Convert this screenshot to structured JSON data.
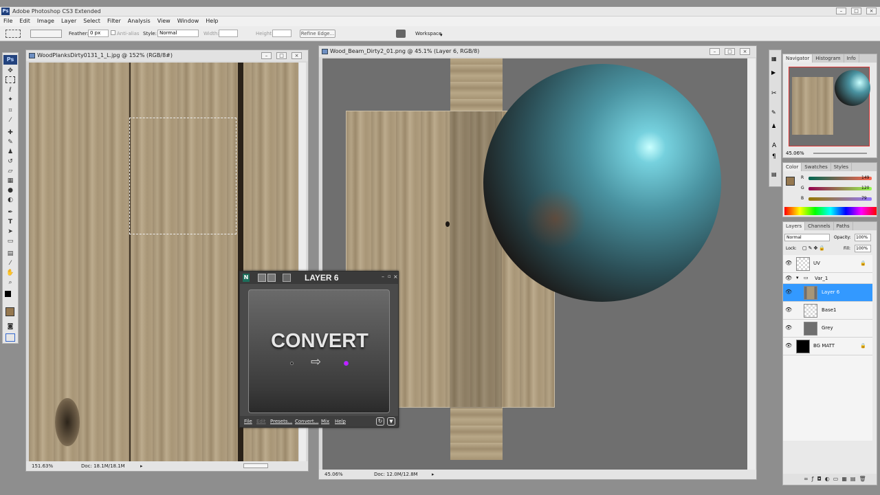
{
  "app": {
    "title": "Adobe Photoshop CS3 Extended",
    "icon_text": "Ps"
  },
  "menu": [
    "File",
    "Edit",
    "Image",
    "Layer",
    "Select",
    "Filter",
    "Analysis",
    "View",
    "Window",
    "Help"
  ],
  "options": {
    "feather_label": "Feather:",
    "feather_value": "0 px",
    "antialias_label": "Anti-alias",
    "style_label": "Style:",
    "style_value": "Normal",
    "width_label": "Width:",
    "height_label": "Height:",
    "refine_edge": "Refine Edge...",
    "workspace": "Workspace"
  },
  "doc1": {
    "title": "WoodPlanksDirty0131_1_L.jpg @ 152% (RGB/8#)",
    "zoom": "151.63%",
    "doc": "Doc: 18.1M/18.1M"
  },
  "doc2": {
    "title": "Wood_Beam_Dirty2_01.png @ 45.1% (Layer 6, RGB/8)",
    "zoom": "45.06%",
    "doc": "Doc: 12.0M/12.8M"
  },
  "plugin": {
    "title": "LAYER 6",
    "big_label": "CONVERT",
    "menu": {
      "file": "File",
      "edit": "Edit",
      "presets": "Presets...",
      "convert": "Convert...",
      "mix": "Mix",
      "help": "Help"
    }
  },
  "navigator": {
    "tabs": [
      "Navigator",
      "Histogram",
      "Info"
    ],
    "zoom": "45.06%"
  },
  "color": {
    "tabs": [
      "Color",
      "Swatches",
      "Styles"
    ],
    "r_label": "R",
    "g_label": "G",
    "b_label": "B",
    "r": "149",
    "g": "120",
    "b": "79",
    "swatch": "#957850"
  },
  "layers": {
    "tabs": [
      "Layers",
      "Channels",
      "Paths"
    ],
    "blend_mode": "Normal",
    "opacity_label": "Opacity:",
    "opacity": "100%",
    "lock_label": "Lock:",
    "fill_label": "Fill:",
    "fill": "100%",
    "items": [
      {
        "name": "UV",
        "locked": true
      },
      {
        "name": "Var_1"
      },
      {
        "name": "Layer 6"
      },
      {
        "name": "Base1"
      },
      {
        "name": "Grey"
      },
      {
        "name": "BG MATT",
        "locked": true
      }
    ]
  },
  "icons": [
    "ps-logo-icon",
    "marquee-icon",
    "move-icon",
    "lasso-icon",
    "magic-wand-icon",
    "crop-icon",
    "eyedropper-icon",
    "brush-icon",
    "stamp-icon",
    "eraser-icon",
    "gradient-icon",
    "dodge-icon",
    "pen-icon",
    "type-icon",
    "path-select-icon",
    "shape-icon",
    "notes-icon",
    "hand-icon",
    "zoom-icon",
    "eye-icon",
    "lock-icon",
    "folder-icon",
    "arrow-right-icon"
  ],
  "colors": {
    "selected_layer": "#3399ff",
    "sphere": "#5fb8c8",
    "canvas_bg": "#6f6f6f"
  }
}
